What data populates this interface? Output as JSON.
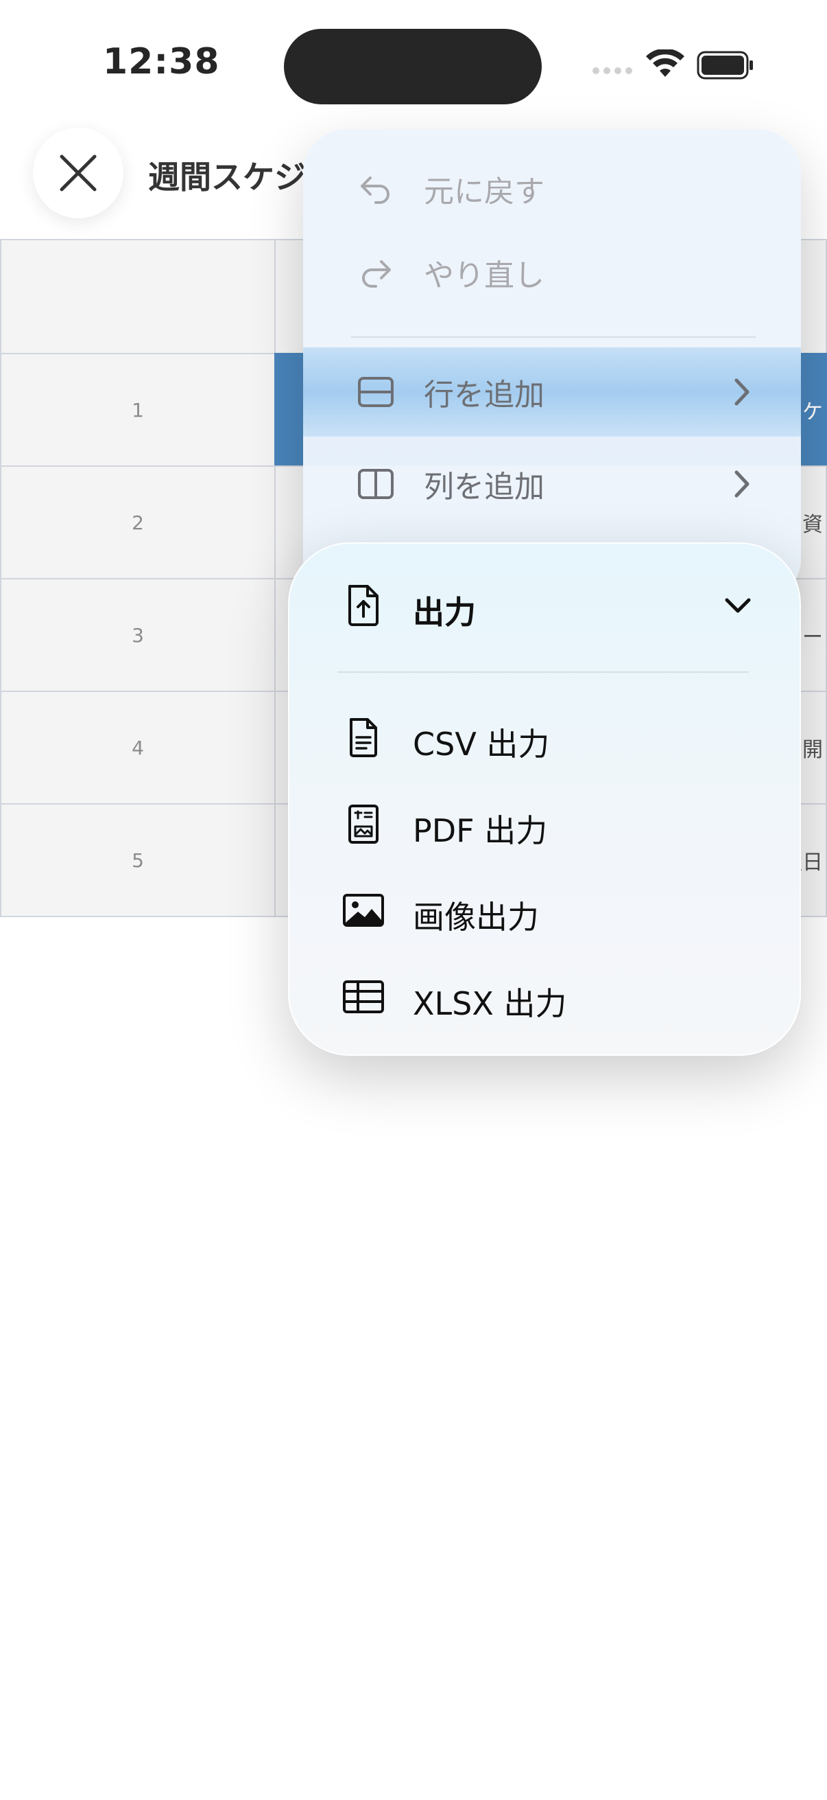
{
  "status_bar": {
    "time": "12:38"
  },
  "header": {
    "title": "週間スケジ"
  },
  "table": {
    "row_numbers": [
      "1",
      "2",
      "3",
      "4",
      "5"
    ],
    "right_cells": [
      "ケ",
      "資",
      "チー",
      "開",
      "翌日"
    ],
    "selected_row": "1",
    "colors": {
      "selected": "#2a6fb0",
      "grid": "#c9ced8",
      "header_bg": "#f2f2f2"
    }
  },
  "menu": {
    "undo": {
      "label": "元に戻す",
      "icon": "undo-icon",
      "enabled": false
    },
    "redo": {
      "label": "やり直し",
      "icon": "redo-icon",
      "enabled": false
    },
    "add_row": {
      "label": "行を追加",
      "icon": "row-icon",
      "highlighted": true
    },
    "add_column": {
      "label": "列を追加",
      "icon": "column-icon"
    }
  },
  "export_menu": {
    "header": {
      "label": "出力",
      "icon": "export-document-icon",
      "expanded": true
    },
    "items": [
      {
        "label": "CSV 出力",
        "icon": "document-icon"
      },
      {
        "label": "PDF 出力",
        "icon": "pdf-icon"
      },
      {
        "label": "画像出力",
        "icon": "image-icon"
      },
      {
        "label": "XLSX 出力",
        "icon": "table-icon"
      }
    ]
  }
}
